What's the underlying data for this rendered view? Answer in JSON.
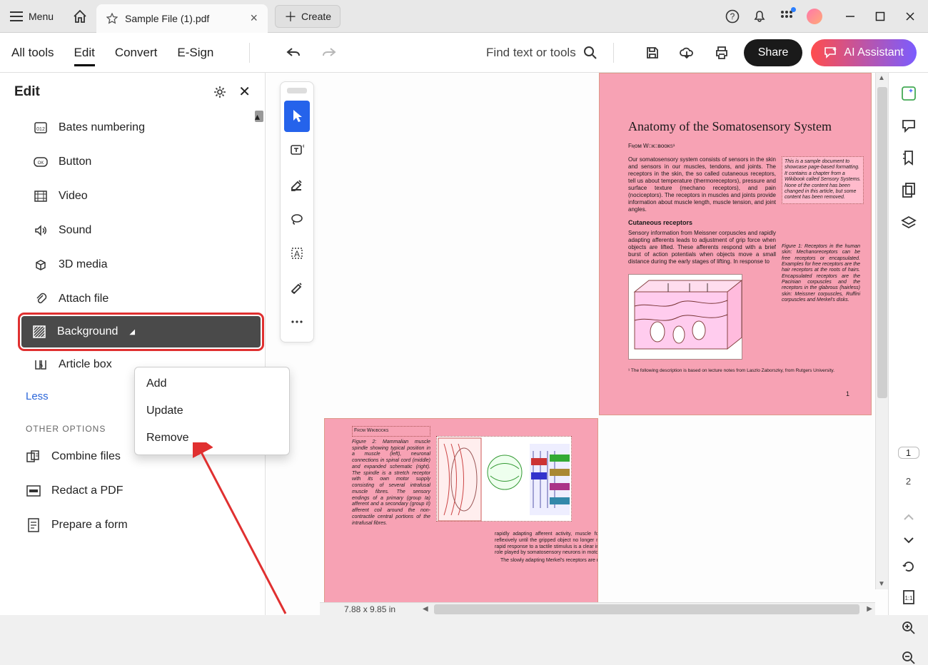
{
  "titlebar": {
    "menu_label": "Menu",
    "tab_title": "Sample File (1).pdf",
    "create_label": "Create"
  },
  "toolbar": {
    "all_tools": "All tools",
    "edit": "Edit",
    "convert": "Convert",
    "esign": "E-Sign",
    "find_label": "Find text or tools",
    "share_label": "Share",
    "ai_label": "AI Assistant"
  },
  "sidebar": {
    "title": "Edit",
    "items": [
      {
        "label": "Bates numbering"
      },
      {
        "label": "Button"
      },
      {
        "label": "Video"
      },
      {
        "label": "Sound"
      },
      {
        "label": "3D media"
      },
      {
        "label": "Attach file"
      },
      {
        "label": "Background"
      },
      {
        "label": "Article box"
      }
    ],
    "less": "Less",
    "other_options": "OTHER OPTIONS",
    "other_items": [
      {
        "label": "Combine files"
      },
      {
        "label": "Redact a PDF"
      },
      {
        "label": "Prepare a form"
      }
    ]
  },
  "context_menu": {
    "items": [
      {
        "label": "Add"
      },
      {
        "label": "Update"
      },
      {
        "label": "Remove"
      }
    ]
  },
  "document": {
    "page1": {
      "title": "Anatomy of the Somatosensory System",
      "subtitle": "Fʀᴏᴍ Wɪᴋɪʙᴏᴏᴋs¹",
      "para1": "Our somatosensory system consists of sensors in the skin and sensors in our muscles, tendons, and joints. The receptors in the skin, the so called cutaneous receptors, tell us about temperature (thermoreceptors), pressure and surface texture (mechano receptors), and pain (nociceptors). The receptors in muscles and joints provide information about muscle length, muscle tension, and joint angles.",
      "sidebox": "This is a sample document to showcase page-based formatting. It contains a chapter from a Wikibook called Sensory Systems. None of the content has been changed in this article, but some content has been removed.",
      "h_cutaneous": "Cutaneous receptors",
      "para2": "Sensory information from Meissner corpuscles and rapidly adapting afferents leads to adjustment of grip force when objects are lifted. These afferents respond with a brief burst of action potentials when objects move a small distance during the early stages of lifting. In response to",
      "figtext": "Figure 1: Receptors in the human skin: Mechanoreceptors can be free receptors or encapsulated. Examples for free receptors are the hair receptors at the roots of hairs. Encapsulated receptors are the Pacinian corpuscles and the receptors in the glabrous (hairless) skin: Meissner corpuscles, Ruffini corpuscles and Merkel's disks.",
      "foot": "¹ The following description is based on lecture notes from Laszlo Zaborszky, from Rutgers University.",
      "pnum": "1"
    },
    "page2": {
      "from": "From Wikibooks",
      "figtext": "Figure 2: Mammalian muscle spindle showing typical position in a muscle (left), neuronal connections in spinal cord (middle) and expanded schematic (right). The spindle is a stretch receptor with its own motor supply consisting of several intrafusal muscle fibres. The sensory endings of a primary (group Ia) afferent and a secondary (group II) afferent coil around the non-contractile central portions of the intrafusal fibres.",
      "body": "rapidly adapting afferent activity, muscle force increases reflexively until the gripped object no longer moves. Such a rapid response to a tactile stimulus is a clear indication of the role played by somatosensory neurons in motor activity.",
      "body2": "The slowly adapting Merkel's receptors are responsible"
    },
    "dims": "7.88 x 9.85 in"
  },
  "rightrail": {
    "page_current": "1",
    "page_total": "2"
  }
}
